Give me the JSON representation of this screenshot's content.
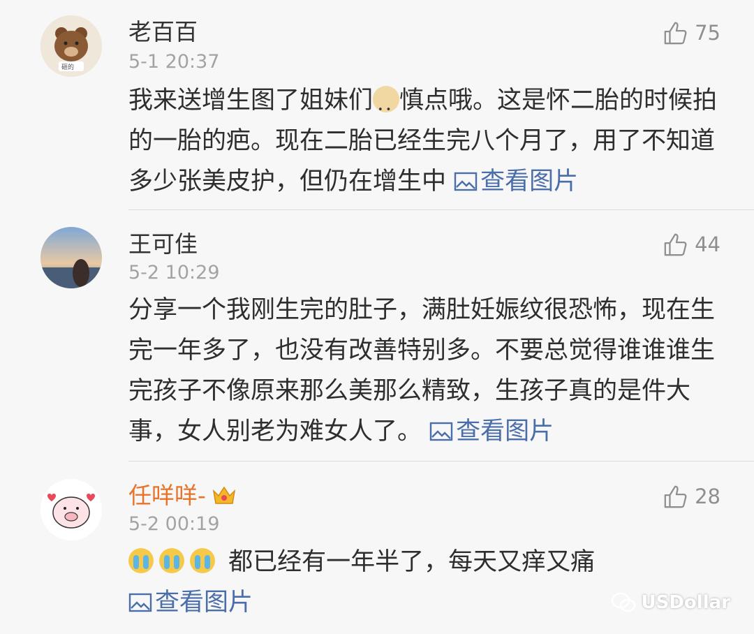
{
  "comments": [
    {
      "user": "老百百",
      "time": "5-1 20:37",
      "likes": "75",
      "text_before": "我来送增生图了姐妹们",
      "text_after": "慎点哦。这是怀二胎的时候拍的一胎的疤。现在二胎已经生完八个月了，用了不知道多少张美皮护，但仍在增生中",
      "view_pic": "查看图片",
      "avatar_text": "砸的"
    },
    {
      "user": "王可佳",
      "time": "5-2 10:29",
      "likes": "44",
      "text": "分享一个我刚生完的肚子，满肚妊娠纹很恐怖，现在生完一年多了，也没有改善特别多。不要总觉得谁谁谁生完孩子不像原来那么美那么精致，生孩子真的是件大事，女人别老为难女人了。",
      "view_pic": "查看图片"
    },
    {
      "user": "任咩咩-",
      "time": "5-2 00:19",
      "likes": "28",
      "text": "都已经有一年半了，每天又痒又痛",
      "view_pic": "查看图片"
    }
  ],
  "watermark": "USDollar"
}
